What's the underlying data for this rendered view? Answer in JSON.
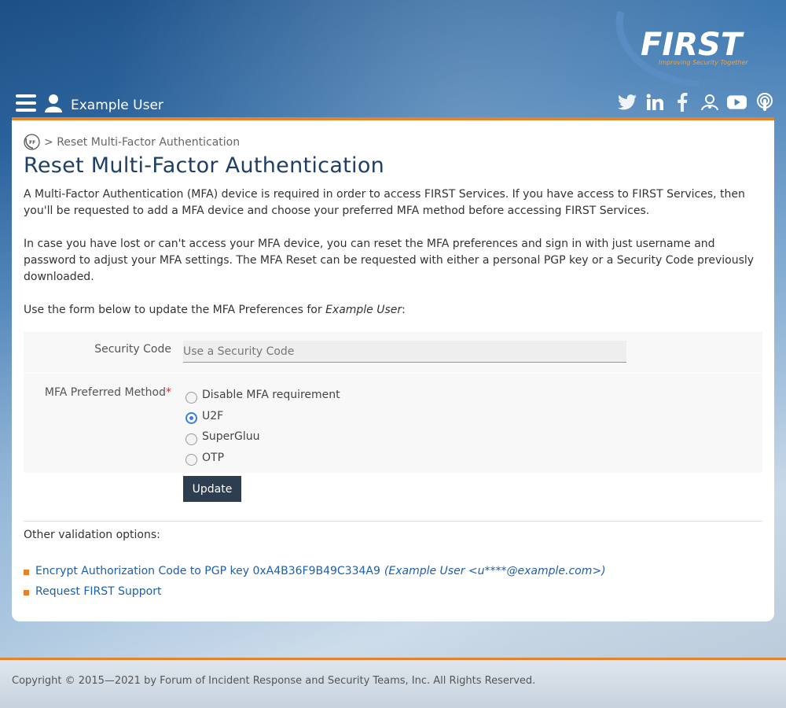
{
  "header": {
    "logo_text": "FIRST",
    "logo_tagline": "Improving Security Together",
    "user_name": "Example User",
    "social": [
      "twitter-icon",
      "linkedin-icon",
      "facebook-icon",
      "first-community-icon",
      "youtube-icon",
      "podcast-icon"
    ]
  },
  "breadcrumb": {
    "separator": ">",
    "current": "Reset Multi-Factor Authentication"
  },
  "page": {
    "title": "Reset Multi-Factor Authentication",
    "para1": "A Multi-Factor Authentication (MFA) device is required in order to access FIRST Services. If you have access to FIRST Services, then you'll be requested to add a MFA device and choose your preferred MFA method before accessing FIRST Services.",
    "para2": "In case you have lost or can't access your MFA device, you can reset the MFA preferences and sign in with just username and password to adjust your MFA settings. The MFA Reset can be requested with either a personal PGP key or a Security Code previously downloaded.",
    "para3_prefix": "Use the form below to update the MFA Preferences for ",
    "para3_user": "Example User",
    "para3_suffix": ":"
  },
  "form": {
    "security_code_label": "Security Code",
    "security_code_placeholder": "Use a Security Code",
    "security_code_value": "",
    "mfa_label": "MFA Preferred Method",
    "required_mark": "*",
    "options": [
      {
        "label": "Disable MFA requirement",
        "checked": false
      },
      {
        "label": "U2F",
        "checked": true
      },
      {
        "label": "SuperGluu",
        "checked": false
      },
      {
        "label": "OTP",
        "checked": false
      }
    ],
    "submit_label": "Update"
  },
  "other": {
    "heading": "Other validation options:",
    "link1_text": "Encrypt Authorization Code to PGP key 0xA4B36F9B49C334A9",
    "link1_detail": "(Example User <u****@example.com>)",
    "link2_text": "Request FIRST Support"
  },
  "footer": {
    "copyright": "Copyright © 2015—2021 by Forum of Incident Response and Security Teams, Inc. All Rights Reserved."
  },
  "colors": {
    "accent_orange": "#e8822a",
    "title_blue": "#1e3f66",
    "link_blue": "#1f5ea8",
    "button_dark": "#2d3e50"
  }
}
